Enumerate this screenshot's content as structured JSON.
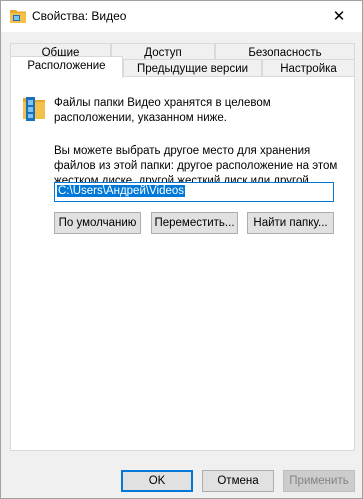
{
  "window": {
    "title": "Свойства: Видео",
    "close_glyph": "✕"
  },
  "tabs": {
    "row1": [
      {
        "label": "Общие"
      },
      {
        "label": "Доступ"
      },
      {
        "label": "Безопасность"
      }
    ],
    "row2": [
      {
        "label": "Расположение",
        "active": true
      },
      {
        "label": "Предыдущие версии"
      },
      {
        "label": "Настройка"
      }
    ]
  },
  "location": {
    "info_text": "Файлы папки Видео хранятся в целевом расположении, указанном ниже.",
    "description": "Вы можете выбрать другое место для хранения файлов из этой папки: другое расположение на этом жестком диске, другой жесткий диск или другой компьютер в этой сети.",
    "path_value": "C:\\Users\\Андрей\\Videos",
    "buttons": {
      "default_label": "По умолчанию",
      "move_label": "Переместить...",
      "find_label": "Найти папку..."
    }
  },
  "footer": {
    "ok_label": "OK",
    "cancel_label": "Отмена",
    "apply_label": "Применить"
  },
  "colors": {
    "accent": "#0078d7",
    "folder": "#f3c14a",
    "film": "#1a6fbf"
  },
  "icons": {
    "title_icon": "video-folder-icon",
    "panel_icon": "video-folder-icon"
  }
}
